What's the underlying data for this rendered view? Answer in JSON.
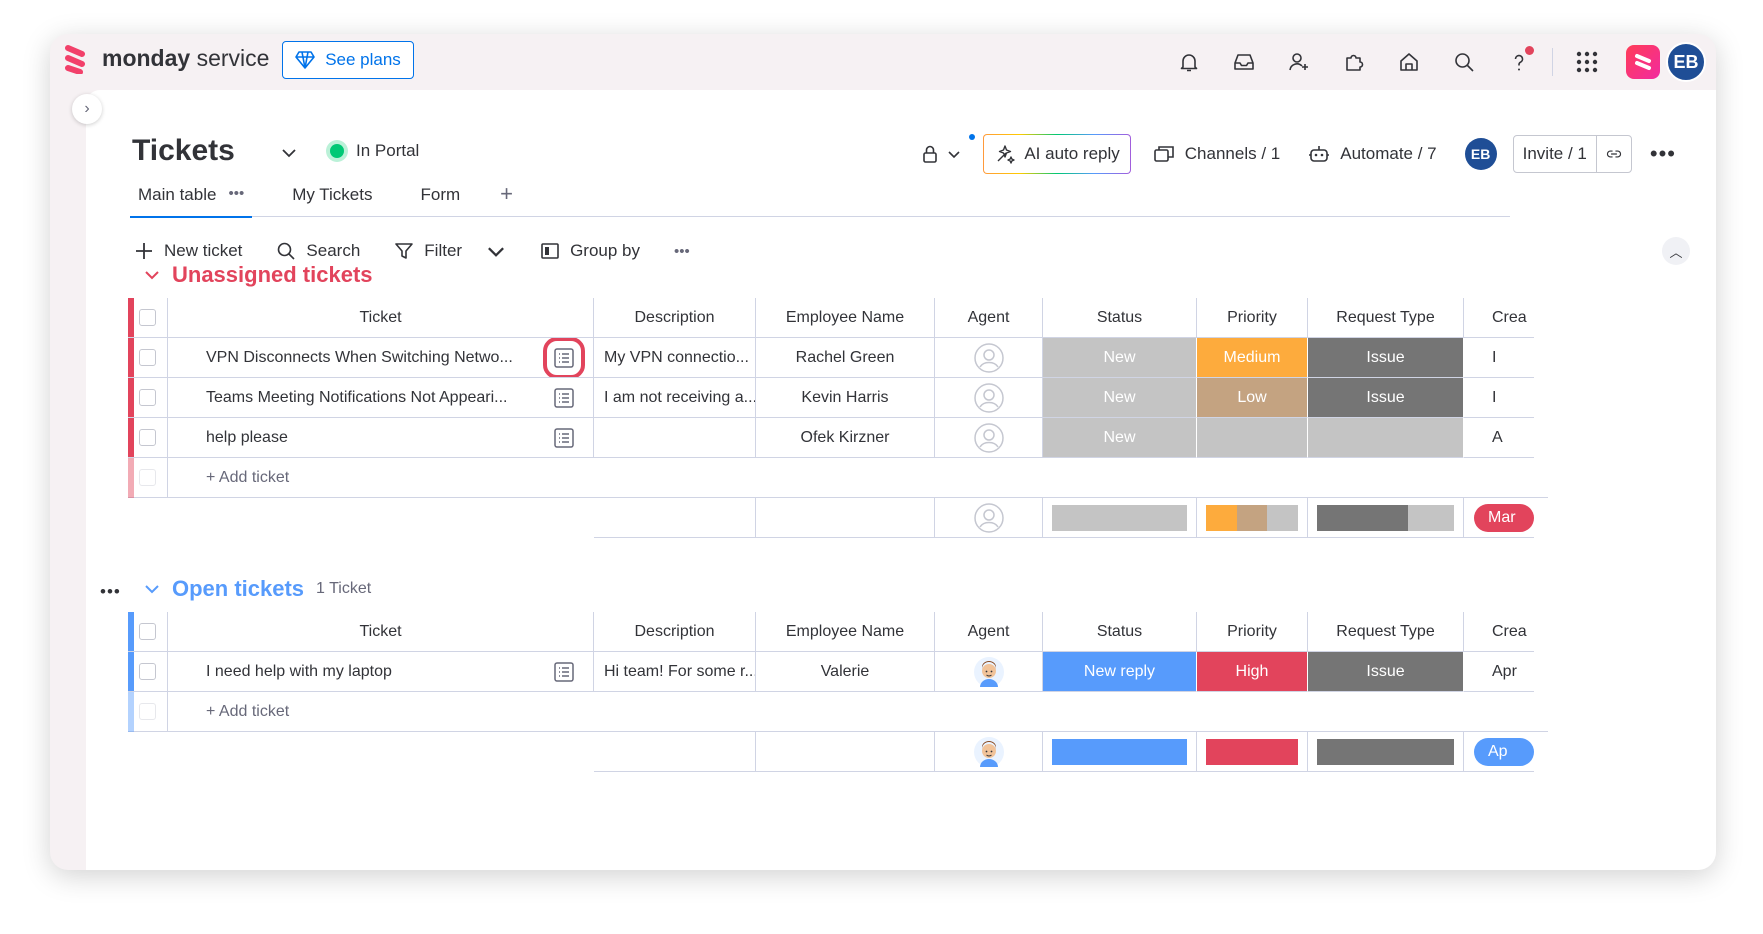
{
  "app": {
    "brand_bold": "monday",
    "brand_rest": " service",
    "see_plans": "See plans"
  },
  "board": {
    "title": "Tickets",
    "portal": "In Portal",
    "ai_reply": "AI auto reply",
    "channels": "Channels / 1",
    "automate": "Automate / 7",
    "user_initials": "EB",
    "invite": "Invite / 1"
  },
  "tabs": [
    {
      "label": "Main table"
    },
    {
      "label": "My Tickets"
    },
    {
      "label": "Form"
    }
  ],
  "toolbar": {
    "new_ticket": "New ticket",
    "search": "Search",
    "filter": "Filter",
    "group_by": "Group by"
  },
  "columns": [
    "Ticket",
    "Description",
    "Employee Name",
    "Agent",
    "Status",
    "Priority",
    "Request Type",
    "Crea"
  ],
  "groups": [
    {
      "title": "Unassigned tickets",
      "count": "",
      "color": "#e2445c",
      "rows": [
        {
          "ticket": "VPN Disconnects When Switching Netwo...",
          "description": "My VPN connectio...",
          "employee": "Rachel Green",
          "status": "New",
          "status_color": "#c4c4c4",
          "priority": "Medium",
          "priority_color": "#fdab3d",
          "request": "Issue",
          "request_color": "#757575",
          "created": "I"
        },
        {
          "ticket": "Teams Meeting Notifications Not Appeari...",
          "description": "I am not receiving a...",
          "employee": "Kevin Harris",
          "status": "New",
          "status_color": "#c4c4c4",
          "priority": "Low",
          "priority_color": "#c4a381",
          "request": "Issue",
          "request_color": "#757575",
          "created": "I"
        },
        {
          "ticket": "help please",
          "description": "",
          "employee": "Ofek Kirzner",
          "status": "New",
          "status_color": "#c4c4c4",
          "priority": "",
          "priority_color": "#c4c4c4",
          "request": "",
          "request_color": "#c4c4c4",
          "created": "A"
        }
      ],
      "add_ticket": "+ Add ticket",
      "summary_date": "Mar"
    },
    {
      "title": "Open tickets",
      "count": "1 Ticket",
      "color": "#579bfc",
      "rows": [
        {
          "ticket": "I need help with my laptop",
          "description": "Hi team! For some r...",
          "employee": "Valerie",
          "status": "New reply",
          "status_color": "#579bfc",
          "priority": "High",
          "priority_color": "#e2445c",
          "request": "Issue",
          "request_color": "#757575",
          "created": "Apr"
        }
      ],
      "add_ticket": "+ Add ticket",
      "summary_date": "Ap"
    }
  ],
  "colors": {
    "accent": "#0073ea",
    "unassigned": "#e2445c",
    "open": "#579bfc"
  }
}
